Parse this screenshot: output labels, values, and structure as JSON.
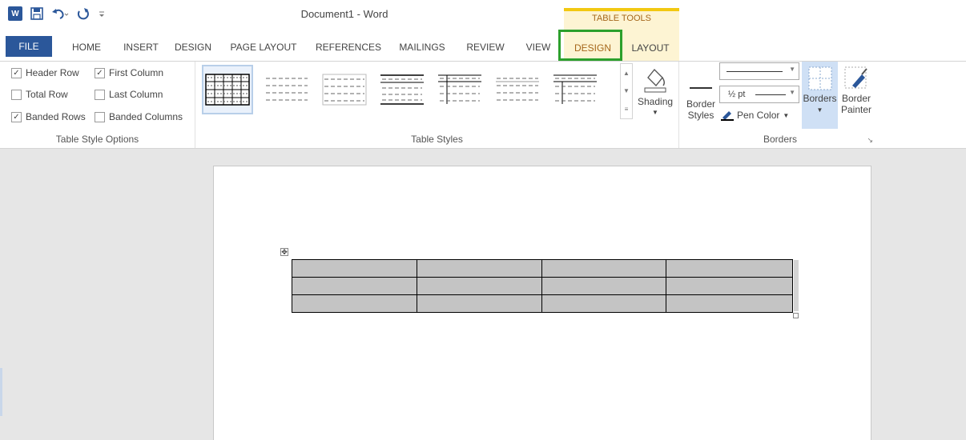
{
  "app": {
    "title": "Document1 - Word",
    "contextual_group": "TABLE TOOLS",
    "accent_color": "#2b579a",
    "contextual_color": "#a5661a",
    "highlight_color": "#2ca02c"
  },
  "quick_access": {
    "logo": "W",
    "icons": [
      "save-icon",
      "undo-icon",
      "redo-icon",
      "customize-icon"
    ]
  },
  "tabs": [
    {
      "label": "FILE"
    },
    {
      "label": "HOME"
    },
    {
      "label": "INSERT"
    },
    {
      "label": "DESIGN"
    },
    {
      "label": "PAGE LAYOUT"
    },
    {
      "label": "REFERENCES"
    },
    {
      "label": "MAILINGS"
    },
    {
      "label": "REVIEW"
    },
    {
      "label": "VIEW"
    },
    {
      "label": "DESIGN"
    },
    {
      "label": "LAYOUT"
    }
  ],
  "table_style_options": {
    "group_label": "Table Style Options",
    "options": [
      {
        "label": "Header Row",
        "checked": true
      },
      {
        "label": "Total Row",
        "checked": false
      },
      {
        "label": "Banded Rows",
        "checked": true
      },
      {
        "label": "First Column",
        "checked": true
      },
      {
        "label": "Last Column",
        "checked": false
      },
      {
        "label": "Banded Columns",
        "checked": false
      }
    ]
  },
  "table_styles": {
    "group_label": "Table Styles",
    "shading_label": "Shading"
  },
  "borders": {
    "group_label": "Borders",
    "border_styles_label_1": "Border",
    "border_styles_label_2": "Styles",
    "pen_weight": "½ pt",
    "pen_color_label": "Pen Color",
    "borders_label": "Borders",
    "painter_label_1": "Border",
    "painter_label_2": "Painter"
  },
  "document": {
    "table": {
      "rows": 3,
      "cols": 4
    }
  }
}
